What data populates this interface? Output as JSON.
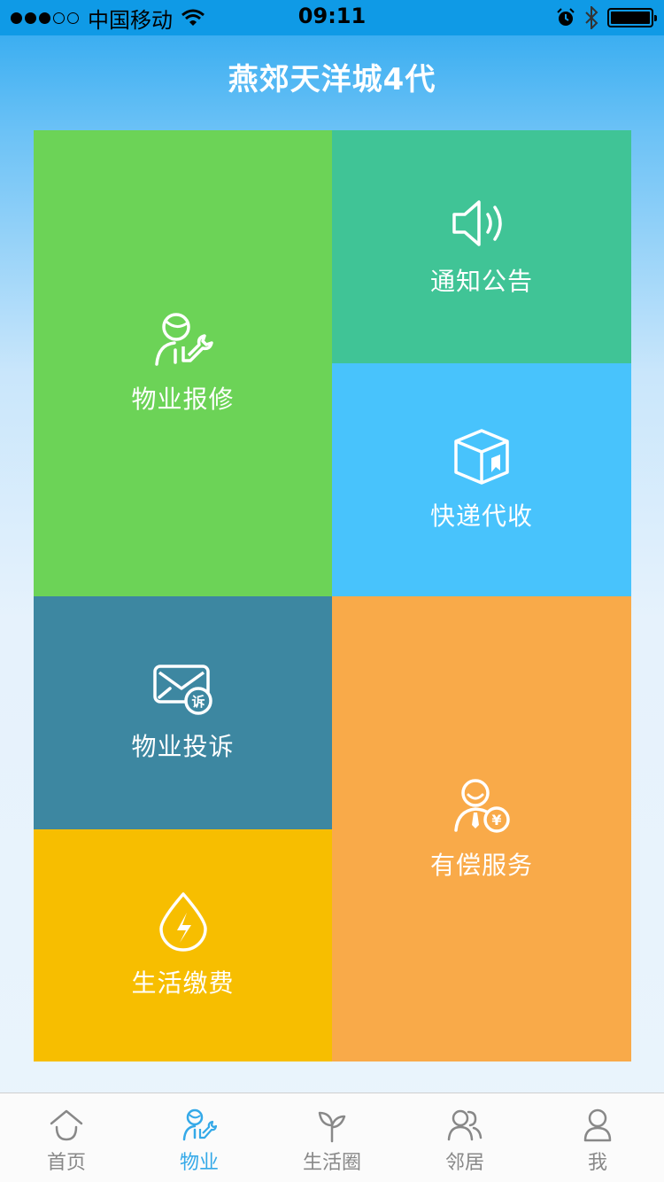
{
  "status_bar": {
    "signal_dots": [
      true,
      true,
      true,
      false,
      false
    ],
    "carrier": "中国移动",
    "time": "09:11",
    "icons": [
      "alarm-icon",
      "bluetooth-icon",
      "battery-icon"
    ]
  },
  "header": {
    "title": "燕郊天洋城4代"
  },
  "tiles": [
    {
      "id": "repair",
      "label": "物业报修",
      "icon": "repair-worker-icon",
      "color": "#6cd357"
    },
    {
      "id": "notice",
      "label": "通知公告",
      "icon": "speaker-icon",
      "color": "#40c496"
    },
    {
      "id": "express",
      "label": "快递代收",
      "icon": "package-icon",
      "color": "#48c3fc"
    },
    {
      "id": "complaint",
      "label": "物业投诉",
      "icon": "complaint-mail-icon",
      "color": "#3d87a1"
    },
    {
      "id": "paid",
      "label": "有偿服务",
      "icon": "paid-service-icon",
      "color": "#f9aa49"
    },
    {
      "id": "pay",
      "label": "生活缴费",
      "icon": "utility-drop-icon",
      "color": "#f7be00"
    }
  ],
  "complaint_badge": "诉",
  "currency_symbol": "¥",
  "tabbar": {
    "items": [
      {
        "label": "首页",
        "icon": "home-icon",
        "active": false
      },
      {
        "label": "物业",
        "icon": "property-icon",
        "active": true
      },
      {
        "label": "生活圈",
        "icon": "sprout-icon",
        "active": false
      },
      {
        "label": "邻居",
        "icon": "neighbors-icon",
        "active": false
      },
      {
        "label": "我",
        "icon": "profile-icon",
        "active": false
      }
    ],
    "active_color": "#34a9e8",
    "inactive_color": "#888888"
  }
}
